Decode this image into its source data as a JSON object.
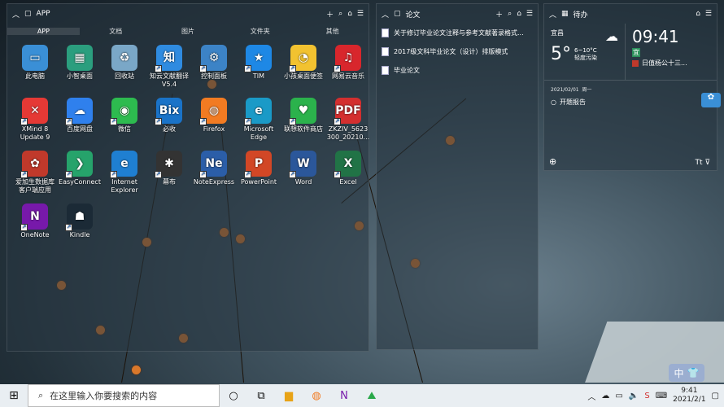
{
  "app_panel": {
    "title": "APP",
    "tabs": [
      "APP",
      "文档",
      "图片",
      "文件夹",
      "其他"
    ],
    "apps": [
      {
        "label": "此电脑",
        "glyph": "▭",
        "color": "#3a8fd6"
      },
      {
        "label": "小智桌面",
        "glyph": "▦",
        "color": "#2b9e7e"
      },
      {
        "label": "回收站",
        "glyph": "♻",
        "color": "#7aa7c7"
      },
      {
        "label": "知云文献翻译 V5.4",
        "glyph": "知",
        "color": "#2f8be0"
      },
      {
        "label": "控制面板",
        "glyph": "⚙",
        "color": "#3c83c6"
      },
      {
        "label": "TIM",
        "glyph": "★",
        "color": "#1e88e5"
      },
      {
        "label": "小孩桌面便签",
        "glyph": "◔",
        "color": "#f2c230"
      },
      {
        "label": "网易云音乐",
        "glyph": "♫",
        "color": "#d8262c"
      },
      {
        "label": "XMind 8 Update 9",
        "glyph": "✕",
        "color": "#e53935"
      },
      {
        "label": "百度网盘",
        "glyph": "☁",
        "color": "#2f80ed"
      },
      {
        "label": "微信",
        "glyph": "◉",
        "color": "#2dbb4f"
      },
      {
        "label": "必收",
        "glyph": "Bix",
        "color": "#1a73c8"
      },
      {
        "label": "Firefox",
        "glyph": "◍",
        "color": "#f27b22"
      },
      {
        "label": "Microsoft Edge",
        "glyph": "e",
        "color": "#1a9ac7"
      },
      {
        "label": "联想软件商店",
        "glyph": "♥",
        "color": "#2bb24c"
      },
      {
        "label": "ZKZIV_5623 300_20210...",
        "glyph": "PDF",
        "color": "#d32f2f"
      },
      {
        "label": "爱加生数据库 客户端应用",
        "glyph": "✿",
        "color": "#c0392b"
      },
      {
        "label": "EasyConnect",
        "glyph": "❯",
        "color": "#26a36b"
      },
      {
        "label": "Internet Explorer",
        "glyph": "e",
        "color": "#1f7fd1"
      },
      {
        "label": "幕布",
        "glyph": "✱",
        "color": "#333333"
      },
      {
        "label": "NoteExpress",
        "glyph": "Ne",
        "color": "#2b5ea8"
      },
      {
        "label": "PowerPoint",
        "glyph": "P",
        "color": "#d24726"
      },
      {
        "label": "Word",
        "glyph": "W",
        "color": "#2b579a"
      },
      {
        "label": "Excel",
        "glyph": "X",
        "color": "#217346"
      },
      {
        "label": "OneNote",
        "glyph": "N",
        "color": "#7719aa"
      },
      {
        "label": "Kindle",
        "glyph": "☗",
        "color": "#1b2a36"
      }
    ]
  },
  "docs_panel": {
    "title": "论文",
    "files": [
      "关于修订毕业论文注释与参考文献著录格式...",
      "2017级文科毕业论文（设计）排版模式",
      "毕业论文"
    ]
  },
  "todo_panel": {
    "title": "待办",
    "city": "宜昌",
    "temp": "5°",
    "temp_range": "6~10°C",
    "condition": "轻度污染",
    "time": "09:41",
    "badge1": "宜",
    "badge2": "日值杨公十三...",
    "date": "2021/02/01",
    "weekday": "周一",
    "todo_item": "开题报告"
  },
  "taskbar": {
    "search_placeholder": "在这里输入你要搜索的内容",
    "time": "9:41",
    "date": "2021/2/1",
    "ime": "中"
  }
}
